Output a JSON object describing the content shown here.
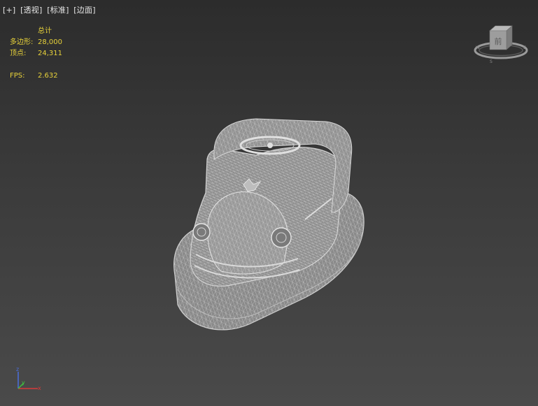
{
  "viewport": {
    "labels": [
      "[+]",
      "[透视]",
      "[标准]",
      "[边面]"
    ]
  },
  "stats": {
    "header": "总计",
    "polygons_label": "多边形:",
    "polygons_value": "28,000",
    "vertices_label": "顶点:",
    "vertices_value": "24,311",
    "fps_label": "FPS:",
    "fps_value": "2.632"
  },
  "viewcube": {
    "face_label": "前"
  },
  "axis_tripod": {
    "x_label": "x",
    "y_label": "y",
    "z_label": "z",
    "x_color": "#d83a3a",
    "y_color": "#3fbf3f",
    "z_color": "#4a6fe0"
  },
  "model": {
    "name": "bumper-car wireframe",
    "fill_color": "#8c8c8c",
    "wire_color": "#d9d9d9"
  }
}
